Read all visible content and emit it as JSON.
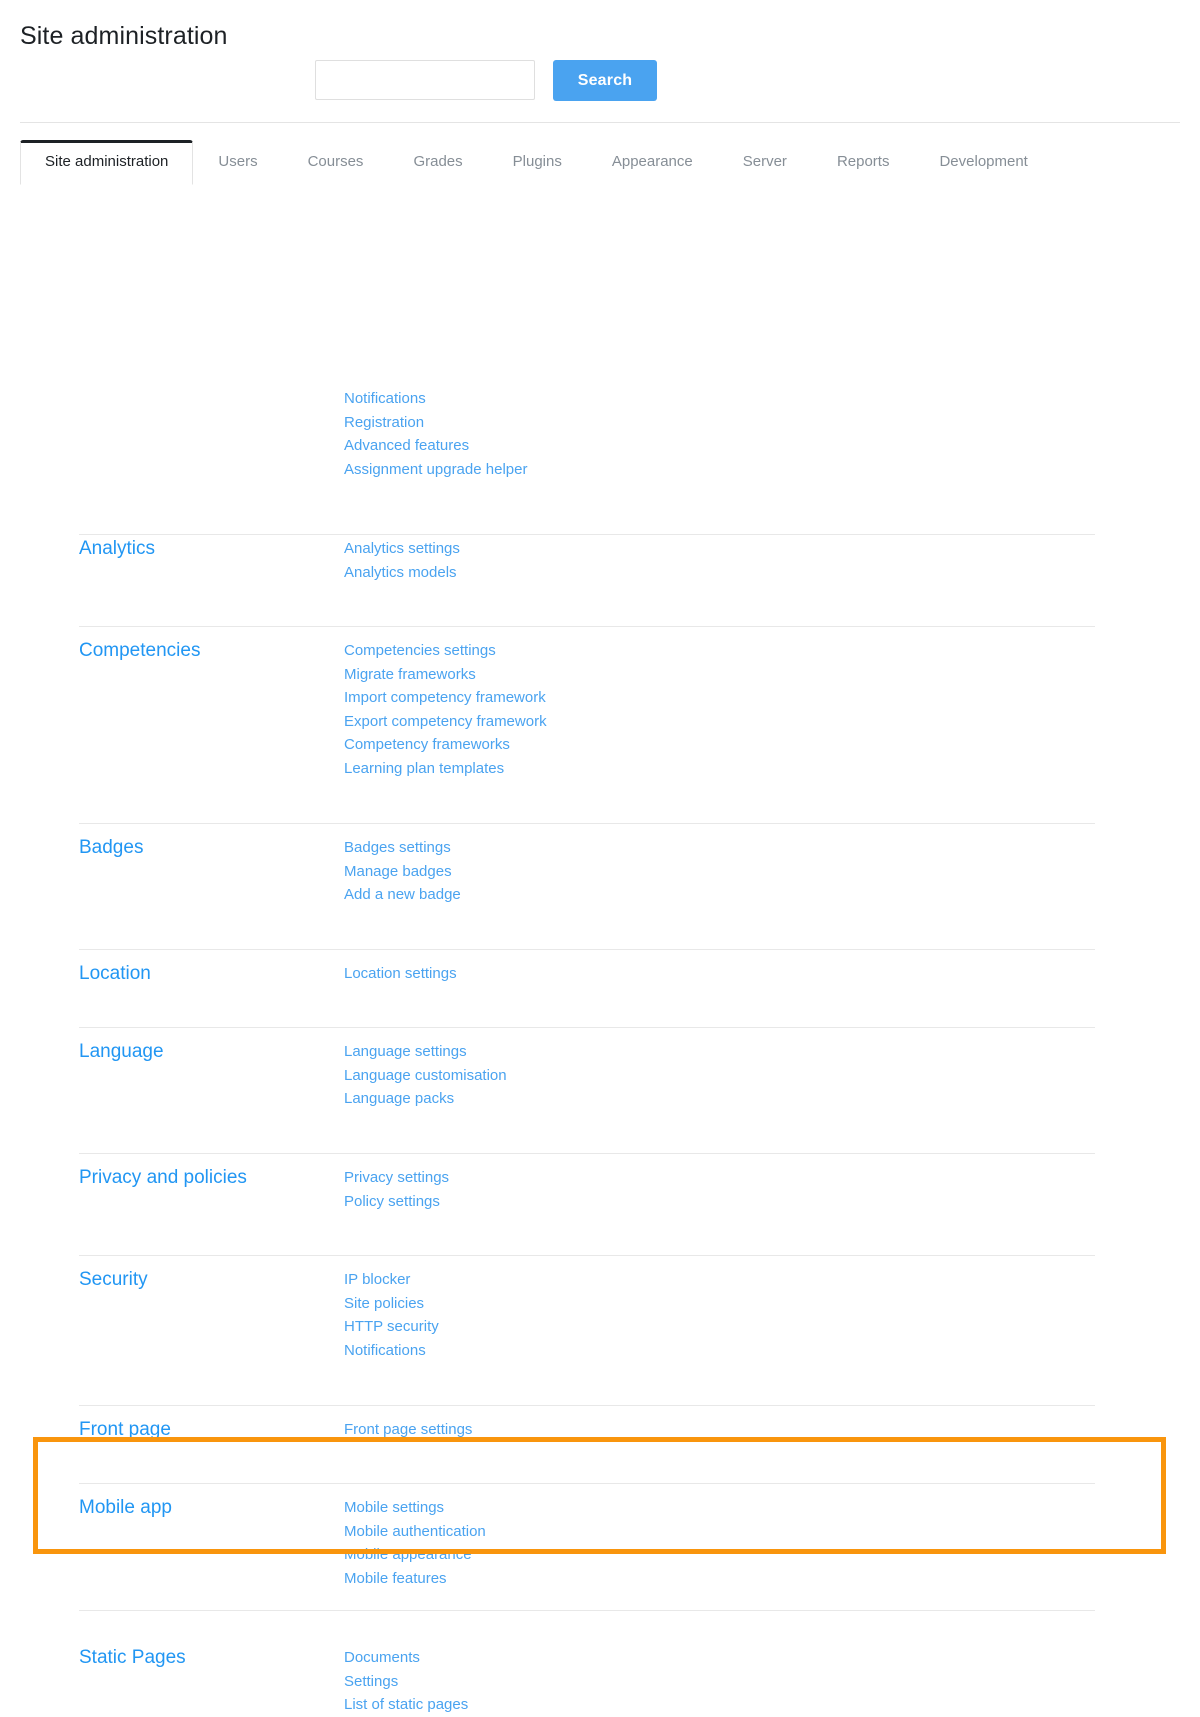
{
  "page": {
    "title": "Site administration"
  },
  "search": {
    "value": "",
    "placeholder": "",
    "button_label": "Search",
    "button_color": "#4aa3f0"
  },
  "tabs": [
    {
      "label": "Site administration",
      "active": true
    },
    {
      "label": "Users",
      "active": false
    },
    {
      "label": "Courses",
      "active": false
    },
    {
      "label": "Grades",
      "active": false
    },
    {
      "label": "Plugins",
      "active": false
    },
    {
      "label": "Appearance",
      "active": false
    },
    {
      "label": "Server",
      "active": false
    },
    {
      "label": "Reports",
      "active": false
    },
    {
      "label": "Development",
      "active": false
    }
  ],
  "colors": {
    "link": "#4aa3f0",
    "heading": "#2196f3",
    "title": "#1d2125",
    "divider": "#e8e8e8",
    "highlight": "#f9950d"
  },
  "sections": [
    {
      "title": "",
      "links": [
        "Notifications",
        "Registration",
        "Advanced features",
        "Assignment upgrade helper"
      ]
    },
    {
      "title": "Analytics",
      "links": [
        "Analytics settings",
        "Analytics models"
      ]
    },
    {
      "title": "Competencies",
      "links": [
        "Competencies settings",
        "Migrate frameworks",
        "Import competency framework",
        "Export competency framework",
        "Competency frameworks",
        "Learning plan templates"
      ]
    },
    {
      "title": "Badges",
      "links": [
        "Badges settings",
        "Manage badges",
        "Add a new badge"
      ]
    },
    {
      "title": "Location",
      "links": [
        "Location settings"
      ]
    },
    {
      "title": "Language",
      "links": [
        "Language settings",
        "Language customisation",
        "Language packs"
      ]
    },
    {
      "title": "Privacy and policies",
      "links": [
        "Privacy settings",
        "Policy settings"
      ]
    },
    {
      "title": "Security",
      "links": [
        "IP blocker",
        "Site policies",
        "HTTP security",
        "Notifications"
      ]
    },
    {
      "title": "Front page",
      "links": [
        "Front page settings"
      ]
    },
    {
      "title": "Mobile app",
      "links": [
        "Mobile settings",
        "Mobile authentication",
        "Mobile appearance",
        "Mobile features"
      ]
    },
    {
      "title": "Static Pages",
      "links": [
        "Documents",
        "Settings",
        "List of static pages"
      ],
      "highlighted": true
    }
  ]
}
